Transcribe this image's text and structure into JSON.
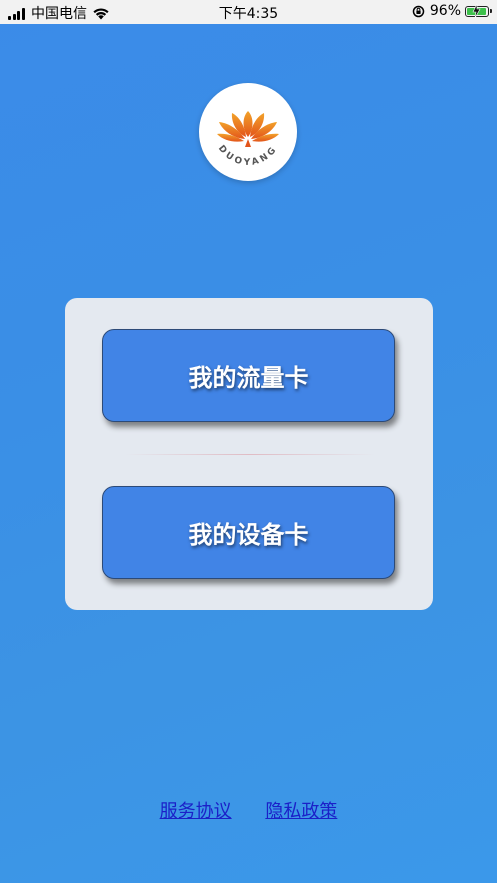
{
  "status_bar": {
    "carrier": "中国电信",
    "time": "下午4:35",
    "battery_percent": "96%",
    "battery_level": 0.96,
    "icons": [
      "signal-icon",
      "wifi-icon",
      "rotation-lock-icon",
      "battery-charging-icon"
    ]
  },
  "logo": {
    "text": "DUOYANG",
    "accent_color": "#e8611c"
  },
  "card": {
    "button_traffic_card": "我的流量卡",
    "button_device_card": "我的设备卡"
  },
  "footer": {
    "service_agreement": "服务协议",
    "privacy_policy": "隐私政策"
  },
  "colors": {
    "background": "#3b8fe7",
    "card": "#e4e9f0",
    "button": "#4184e6",
    "link": "#1b20c8"
  }
}
